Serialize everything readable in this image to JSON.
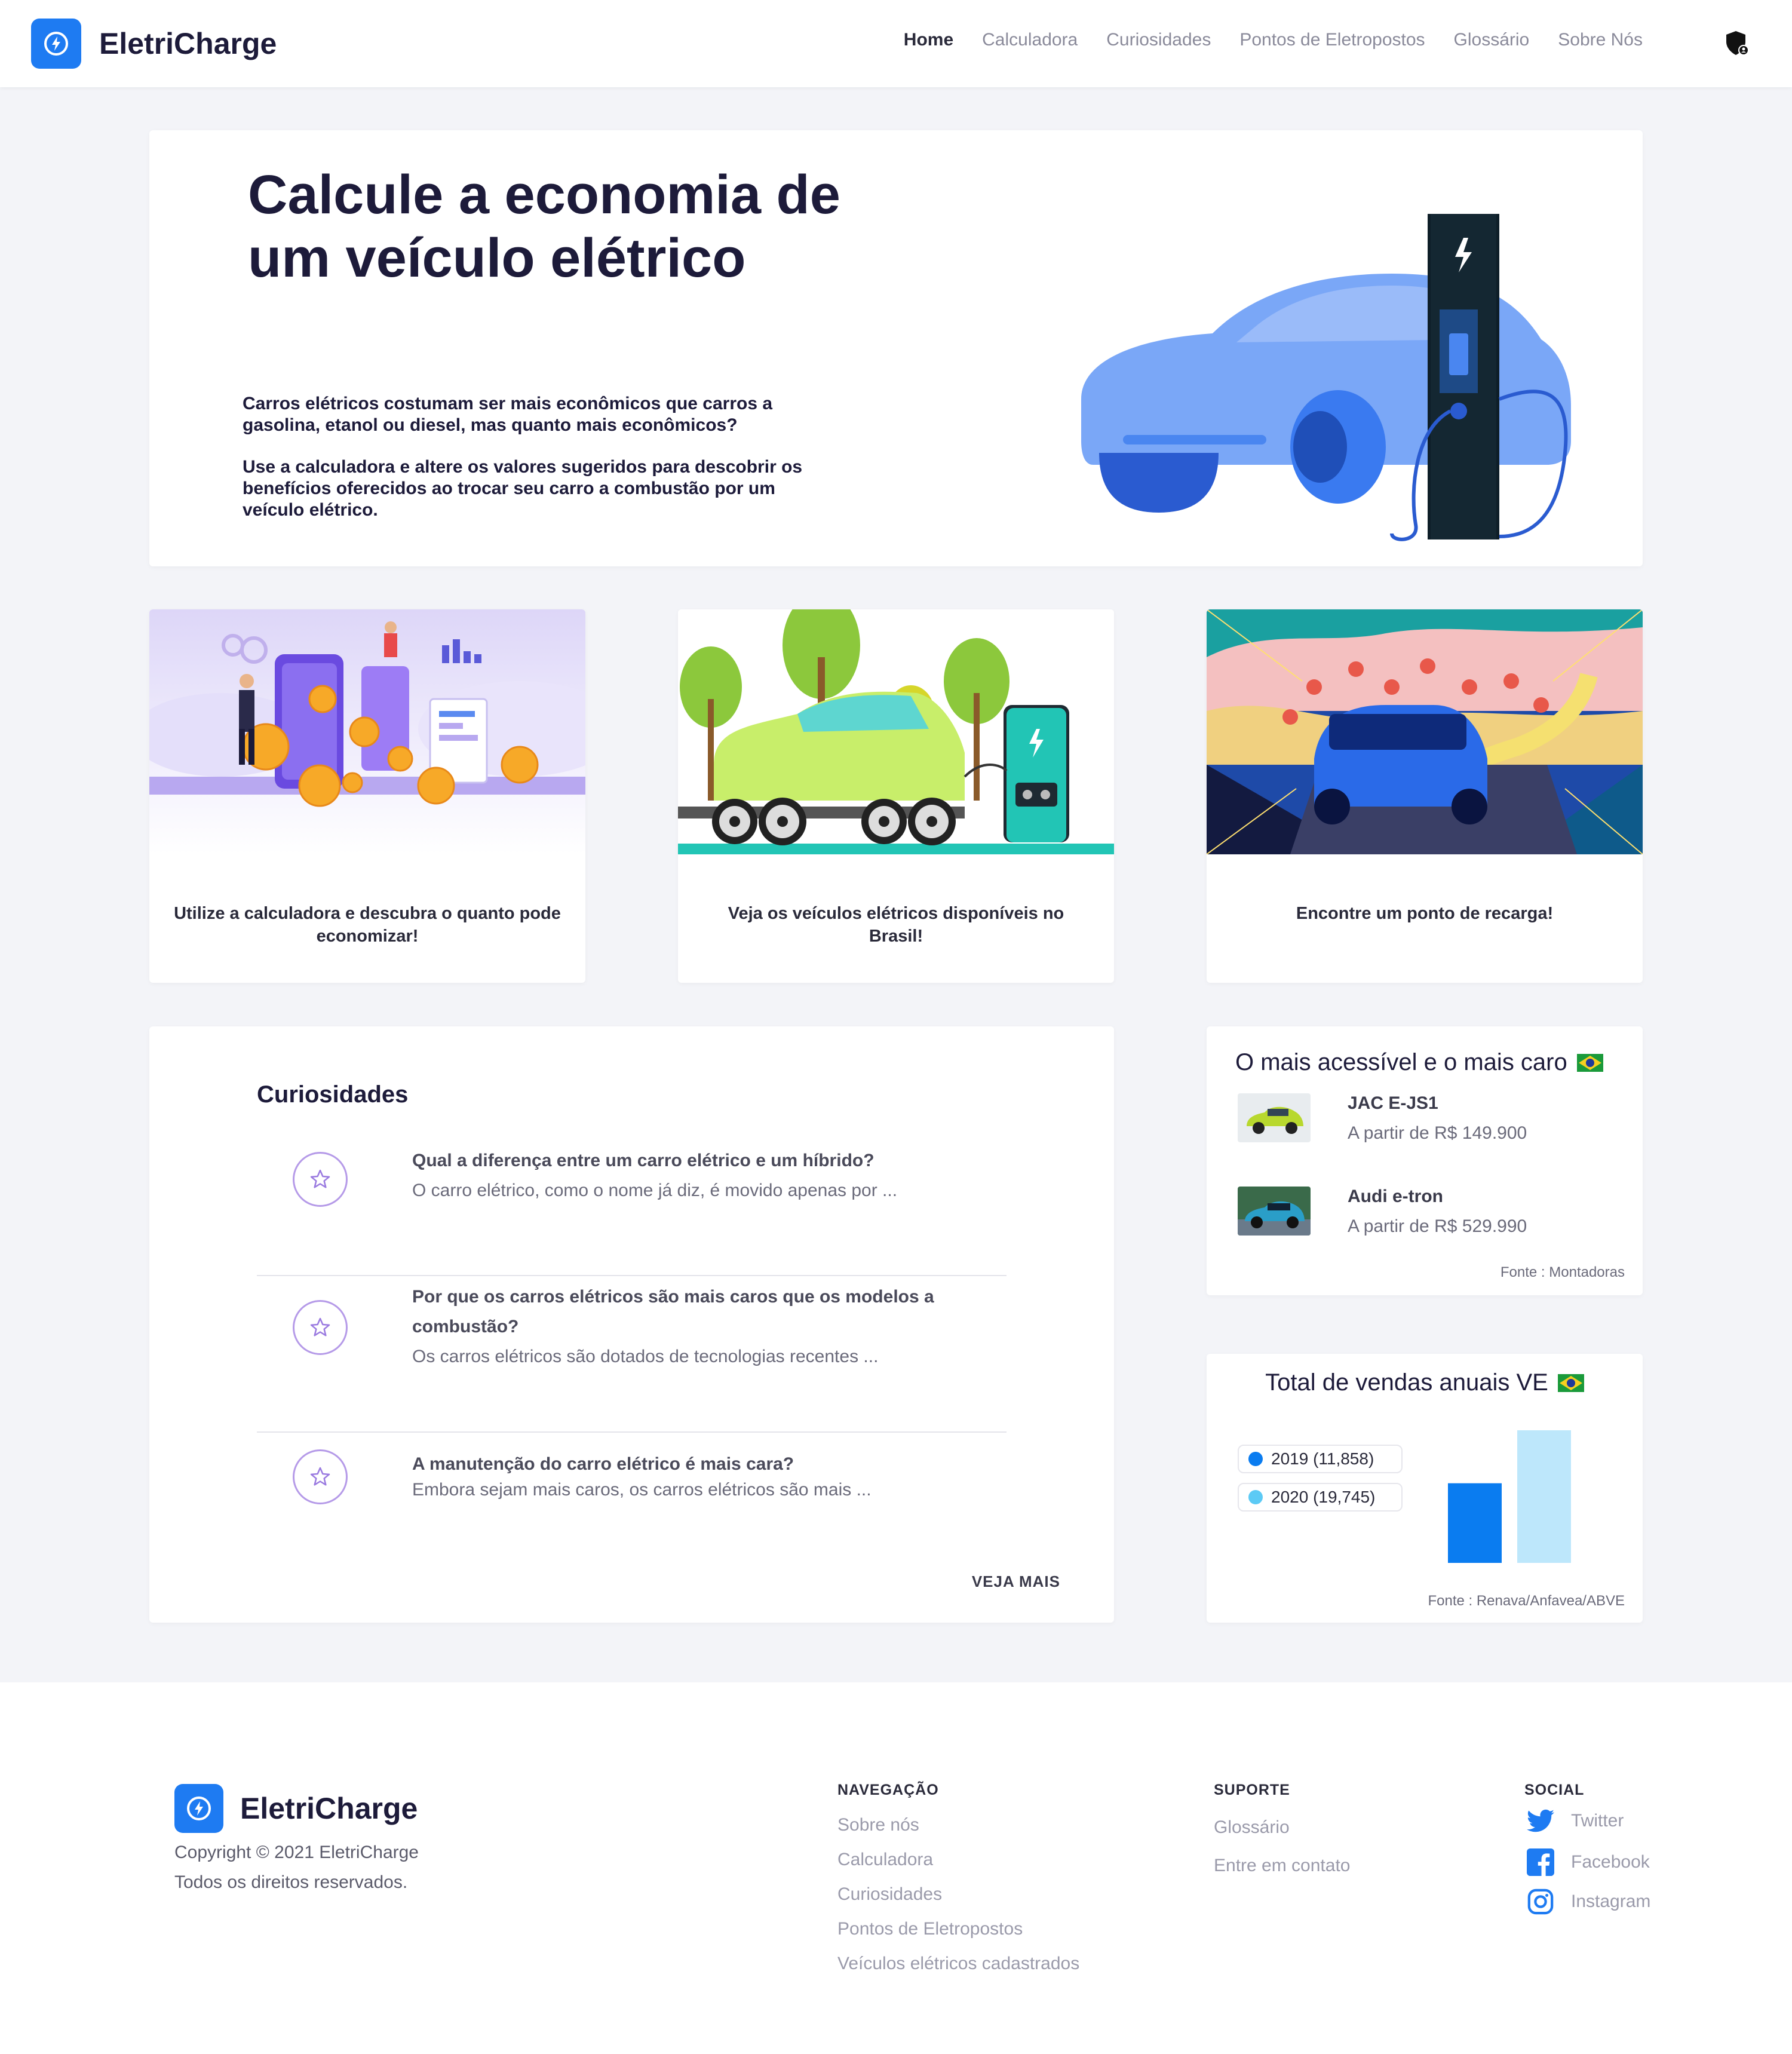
{
  "header": {
    "brand": "EletriCharge",
    "nav": [
      {
        "label": "Home",
        "active": true
      },
      {
        "label": "Calculadora"
      },
      {
        "label": "Curiosidades"
      },
      {
        "label": "Pontos de Eletropostos"
      },
      {
        "label": "Glossário"
      },
      {
        "label": "Sobre Nós"
      }
    ]
  },
  "hero": {
    "title": "Calcule a economia de um veículo elétrico",
    "p1": "Carros elétricos costumam ser mais econômicos que carros a gasolina, etanol ou diesel, mas quanto mais econômicos?",
    "p2": "Use a calculadora e altere os valores sugeridos para descobrir os benefícios oferecidos ao trocar seu carro a combustão por um veículo elétrico."
  },
  "features": [
    {
      "caption": "Utilize a calculadora e descubra o quanto pode economizar!"
    },
    {
      "caption": "Veja os veículos elétricos disponíveis no Brasil!"
    },
    {
      "caption": "Encontre um ponto de recarga!"
    }
  ],
  "curiosidades": {
    "title": "Curiosidades",
    "items": [
      {
        "question": "Qual a diferença entre um carro elétrico e um híbrido?",
        "answer": "O carro elétrico, como o nome já diz, é movido apenas por ..."
      },
      {
        "question": "Por que os carros elétricos são mais caros que os modelos a combustão?",
        "answer": "Os carros elétricos são dotados de tecnologias recentes ..."
      },
      {
        "question": "A manutenção do carro elétrico é mais cara?",
        "answer": "Embora sejam mais caros, os carros elétricos são mais ..."
      }
    ],
    "see_more": "VEJA MAIS"
  },
  "cars": {
    "title": "O mais acessível e o mais caro",
    "items": [
      {
        "name": "JAC E-JS1",
        "price": "A partir de R$ 149.900",
        "color": "#b8d82e"
      },
      {
        "name": "Audi e-tron",
        "price": "A partir de R$ 529.990",
        "color": "#2a9ec8"
      }
    ],
    "source": "Fonte : Montadoras"
  },
  "sales": {
    "title": "Total de vendas anuais VE",
    "legend": [
      {
        "label": "2019 (11,858)",
        "color": "#0a7cf0"
      },
      {
        "label": "2020 (19,745)",
        "color": "#5ccaf5"
      }
    ],
    "source": "Fonte : Renava/Anfavea/ABVE"
  },
  "chart_data": {
    "type": "bar",
    "categories": [
      "2019",
      "2020"
    ],
    "values": [
      11858,
      19745
    ],
    "colors": [
      "#0a7cf0",
      "#bde7fb"
    ],
    "title": "Total de vendas anuais VE",
    "ylim": [
      0,
      19745
    ]
  },
  "footer": {
    "brand": "EletriCharge",
    "copyright": "Copyright © 2021 EletriCharge",
    "rights": "Todos os direitos reservados.",
    "nav_title": "NAVEGAÇÃO",
    "nav_links": [
      "Sobre nós",
      "Calculadora",
      "Curiosidades",
      "Pontos de Eletropostos",
      "Veículos elétricos cadastrados"
    ],
    "support_title": "SUPORTE",
    "support_links": [
      "Glossário",
      "Entre em contato"
    ],
    "social_title": "SOCIAL",
    "social_links": [
      {
        "label": "Twitter",
        "icon": "twitter-icon"
      },
      {
        "label": "Facebook",
        "icon": "facebook-icon"
      },
      {
        "label": "Instagram",
        "icon": "instagram-icon"
      }
    ]
  }
}
